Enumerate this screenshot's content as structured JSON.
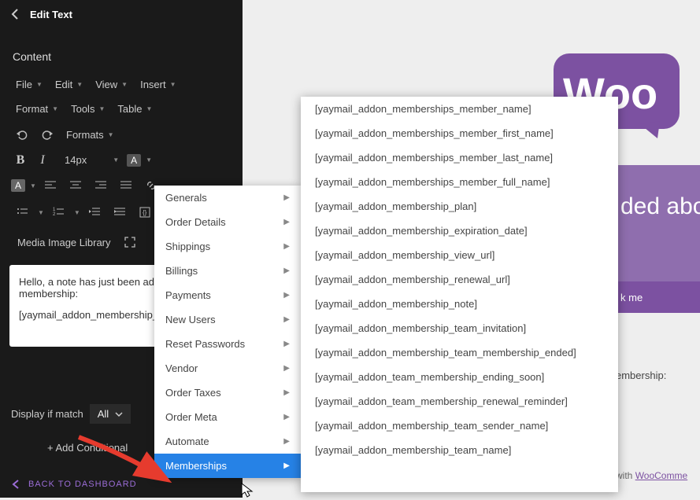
{
  "header": {
    "title": "Edit Text"
  },
  "subheader": "Content",
  "topmenu": {
    "file": "File",
    "edit": "Edit",
    "view": "View",
    "insert": "Insert",
    "format": "Format",
    "tools": "Tools",
    "table": "Table"
  },
  "toolbar": {
    "formats": "Formats",
    "fontsize": "14px",
    "media": "Media Image Library"
  },
  "editor": {
    "l1": "Hello, a note has just been added about your membership:",
    "l2": "[yaymail_addon_membership_note]"
  },
  "display": {
    "label": "Display if match",
    "all": "All"
  },
  "addcond": "+ Add Conditional",
  "backdash": "BACK TO DASHBOARD",
  "menu1": {
    "generals": "Generals",
    "orderdetails": "Order Details",
    "shippings": "Shippings",
    "billings": "Billings",
    "payments": "Payments",
    "newusers": "New Users",
    "resetpw": "Reset Passwords",
    "vendor": "Vendor",
    "ordertaxes": "Order Taxes",
    "ordermeta": "Order Meta",
    "automate": "Automate",
    "memberships": "Memberships"
  },
  "menu2": [
    "[yaymail_addon_memberships_member_name]",
    "[yaymail_addon_memberships_member_first_name]",
    "[yaymail_addon_memberships_member_last_name]",
    "[yaymail_addon_memberships_member_full_name]",
    "[yaymail_addon_membership_plan]",
    "[yaymail_addon_membership_expiration_date]",
    "[yaymail_addon_membership_view_url]",
    "[yaymail_addon_membership_renewal_url]",
    "[yaymail_addon_membership_note]",
    "[yaymail_addon_membership_team_invitation]",
    "[yaymail_addon_membership_team_membership_ended]",
    "[yaymail_addon_team_membership_ending_soon]",
    "[yaymail_addon_team_membership_renewal_reminder]",
    "[yaymail_addon_membership_team_sender_name]",
    "[yaymail_addon_membership_team_name]"
  ],
  "preview": {
    "banner": "ded abo",
    "btn": "k me",
    "membership": "embership:",
    "built_prefix": "with ",
    "wc": "WooComme"
  }
}
